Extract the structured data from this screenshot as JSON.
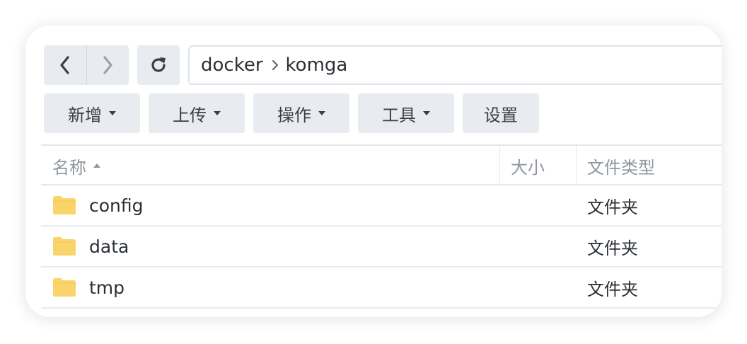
{
  "toolbar": {
    "back_icon": "chevron-left-icon",
    "forward_icon": "chevron-right-icon",
    "refresh_icon": "refresh-icon",
    "path": [
      "docker",
      "komga"
    ],
    "menus": [
      {
        "label": "新增"
      },
      {
        "label": "上传"
      },
      {
        "label": "操作"
      },
      {
        "label": "工具"
      }
    ],
    "settings_label": "设置"
  },
  "table": {
    "columns": {
      "name": "名称",
      "size": "大小",
      "type": "文件类型"
    },
    "rows": [
      {
        "name": "config",
        "size": "",
        "type": "文件夹"
      },
      {
        "name": "data",
        "size": "",
        "type": "文件夹"
      },
      {
        "name": "tmp",
        "size": "",
        "type": "文件夹"
      }
    ]
  },
  "colors": {
    "button_bg": "#e8ecf0",
    "folder": "#f9d46b",
    "text": "#2b3036",
    "header_text": "#8f969d"
  }
}
